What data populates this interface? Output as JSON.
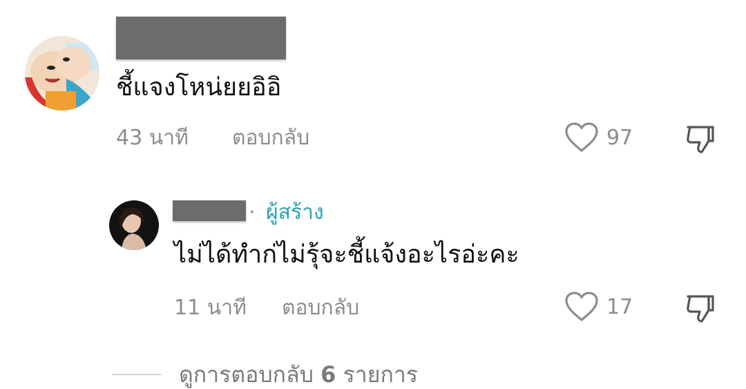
{
  "colors": {
    "text_primary": "#111111",
    "text_secondary": "#8c8c8c",
    "creator_accent": "#2aa0b8",
    "redaction": "#6c6c6c",
    "divider": "#cfcfcf"
  },
  "comments": [
    {
      "username_redacted": true,
      "avatar": "cartoon-avatar",
      "text": "ชี้แจงโหน่ยยอิอิ",
      "time": "43 นาที",
      "reply_label": "ตอบกลับ",
      "like_icon": "heart-outline-icon",
      "like_count": "97",
      "dislike_icon": "thumbs-down-icon"
    },
    {
      "username_redacted": true,
      "avatar": "user-photo-avatar",
      "badge_separator": "·",
      "badge_label": "ผู้สร้าง",
      "text": "ไม่ได้ทำก่ไม่รุ้จะชี้แจ้งอะไรอ่ะคะ",
      "time": "11 นาที",
      "reply_label": "ตอบกลับ",
      "like_icon": "heart-outline-icon",
      "like_count": "17",
      "dislike_icon": "thumbs-down-icon"
    }
  ],
  "view_replies": {
    "label_prefix": "ดูการตอบกลับ ",
    "count": "6",
    "label_suffix": " รายการ"
  }
}
